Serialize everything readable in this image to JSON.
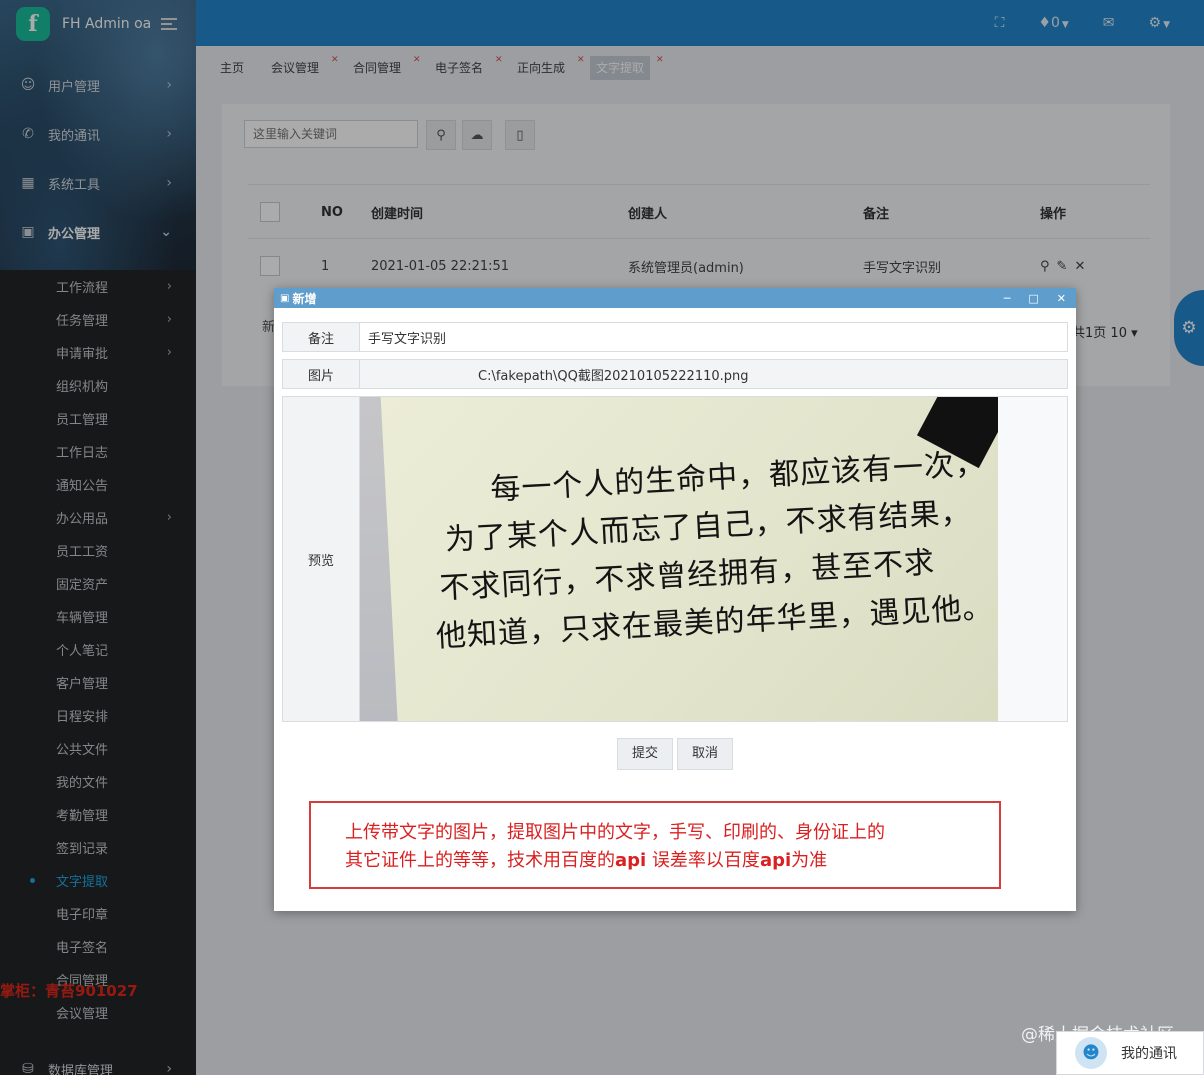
{
  "brand": {
    "title": "FH Admin oa",
    "logo_letter": "f"
  },
  "sidebar": {
    "top_items": [
      {
        "label": "用户管理",
        "icon": "users-icon"
      },
      {
        "label": "我的通讯",
        "icon": "phone-icon"
      },
      {
        "label": "系统工具",
        "icon": "grid-icon"
      },
      {
        "label": "办公管理",
        "icon": "briefcase-icon"
      }
    ],
    "sub_items": [
      {
        "label": "工作流程",
        "chevron": true
      },
      {
        "label": "任务管理",
        "chevron": true
      },
      {
        "label": "申请审批",
        "chevron": true
      },
      {
        "label": "组织机构"
      },
      {
        "label": "员工管理"
      },
      {
        "label": "工作日志"
      },
      {
        "label": "通知公告"
      },
      {
        "label": "办公用品",
        "chevron": true
      },
      {
        "label": "员工工资"
      },
      {
        "label": "固定资产"
      },
      {
        "label": "车辆管理"
      },
      {
        "label": "个人笔记"
      },
      {
        "label": "客户管理"
      },
      {
        "label": "日程安排"
      },
      {
        "label": "公共文件"
      },
      {
        "label": "我的文件"
      },
      {
        "label": "考勤管理"
      },
      {
        "label": "签到记录"
      },
      {
        "label": "文字提取",
        "current": true
      },
      {
        "label": "电子印章"
      },
      {
        "label": "电子签名"
      },
      {
        "label": "合同管理"
      },
      {
        "label": "会议管理"
      }
    ],
    "bottom_item": "数据库管理",
    "shopkeeper_note": "掌柜：青苔901027"
  },
  "header": {
    "notify_count": "0"
  },
  "tabs": [
    {
      "label": "主页",
      "closable": false
    },
    {
      "label": "会议管理",
      "closable": true
    },
    {
      "label": "合同管理",
      "closable": true
    },
    {
      "label": "电子签名",
      "closable": true
    },
    {
      "label": "正向生成",
      "closable": true
    },
    {
      "label": "文字提取",
      "closable": true,
      "active": true
    }
  ],
  "search": {
    "placeholder": "这里输入关键词"
  },
  "table": {
    "headers": {
      "no": "NO",
      "created": "创建时间",
      "creator": "创建人",
      "remark": "备注",
      "ops": "操作"
    },
    "rows": [
      {
        "no": "1",
        "created": "2021-01-05 22:21:51",
        "creator": "系统管理员(admin)",
        "remark": "手写文字识别"
      }
    ]
  },
  "pager": {
    "left_fragment": "新",
    "info": "共1页",
    "page_size": "10"
  },
  "dialog": {
    "title": "新增",
    "remark_label": "备注",
    "remark_value": "手写文字识别",
    "image_label": "图片",
    "image_path": "C:\\fakepath\\QQ截图20210105222110.png",
    "preview_label": "预览",
    "handwriting": [
      "每一个人的生命中，都应该有一次，",
      "为了某个人而忘了自己，不求有结果，",
      "不求同行，不求曾经拥有，甚至不求",
      "他知道，只求在最美的年华里，遇见他。"
    ],
    "submit_label": "提交",
    "cancel_label": "取消"
  },
  "annotation": {
    "line1": "上传带文字的图片，提取图片中的文字，手写、印刷的、身份证上的",
    "line2a": "其它证件上的等等，技术用百度的",
    "line2b": "api",
    "line2c": " 误差率以百度",
    "line2d": "api",
    "line2e": "为准"
  },
  "watermark": "@稀土掘金技术社区",
  "chat": {
    "label": "我的通讯"
  }
}
